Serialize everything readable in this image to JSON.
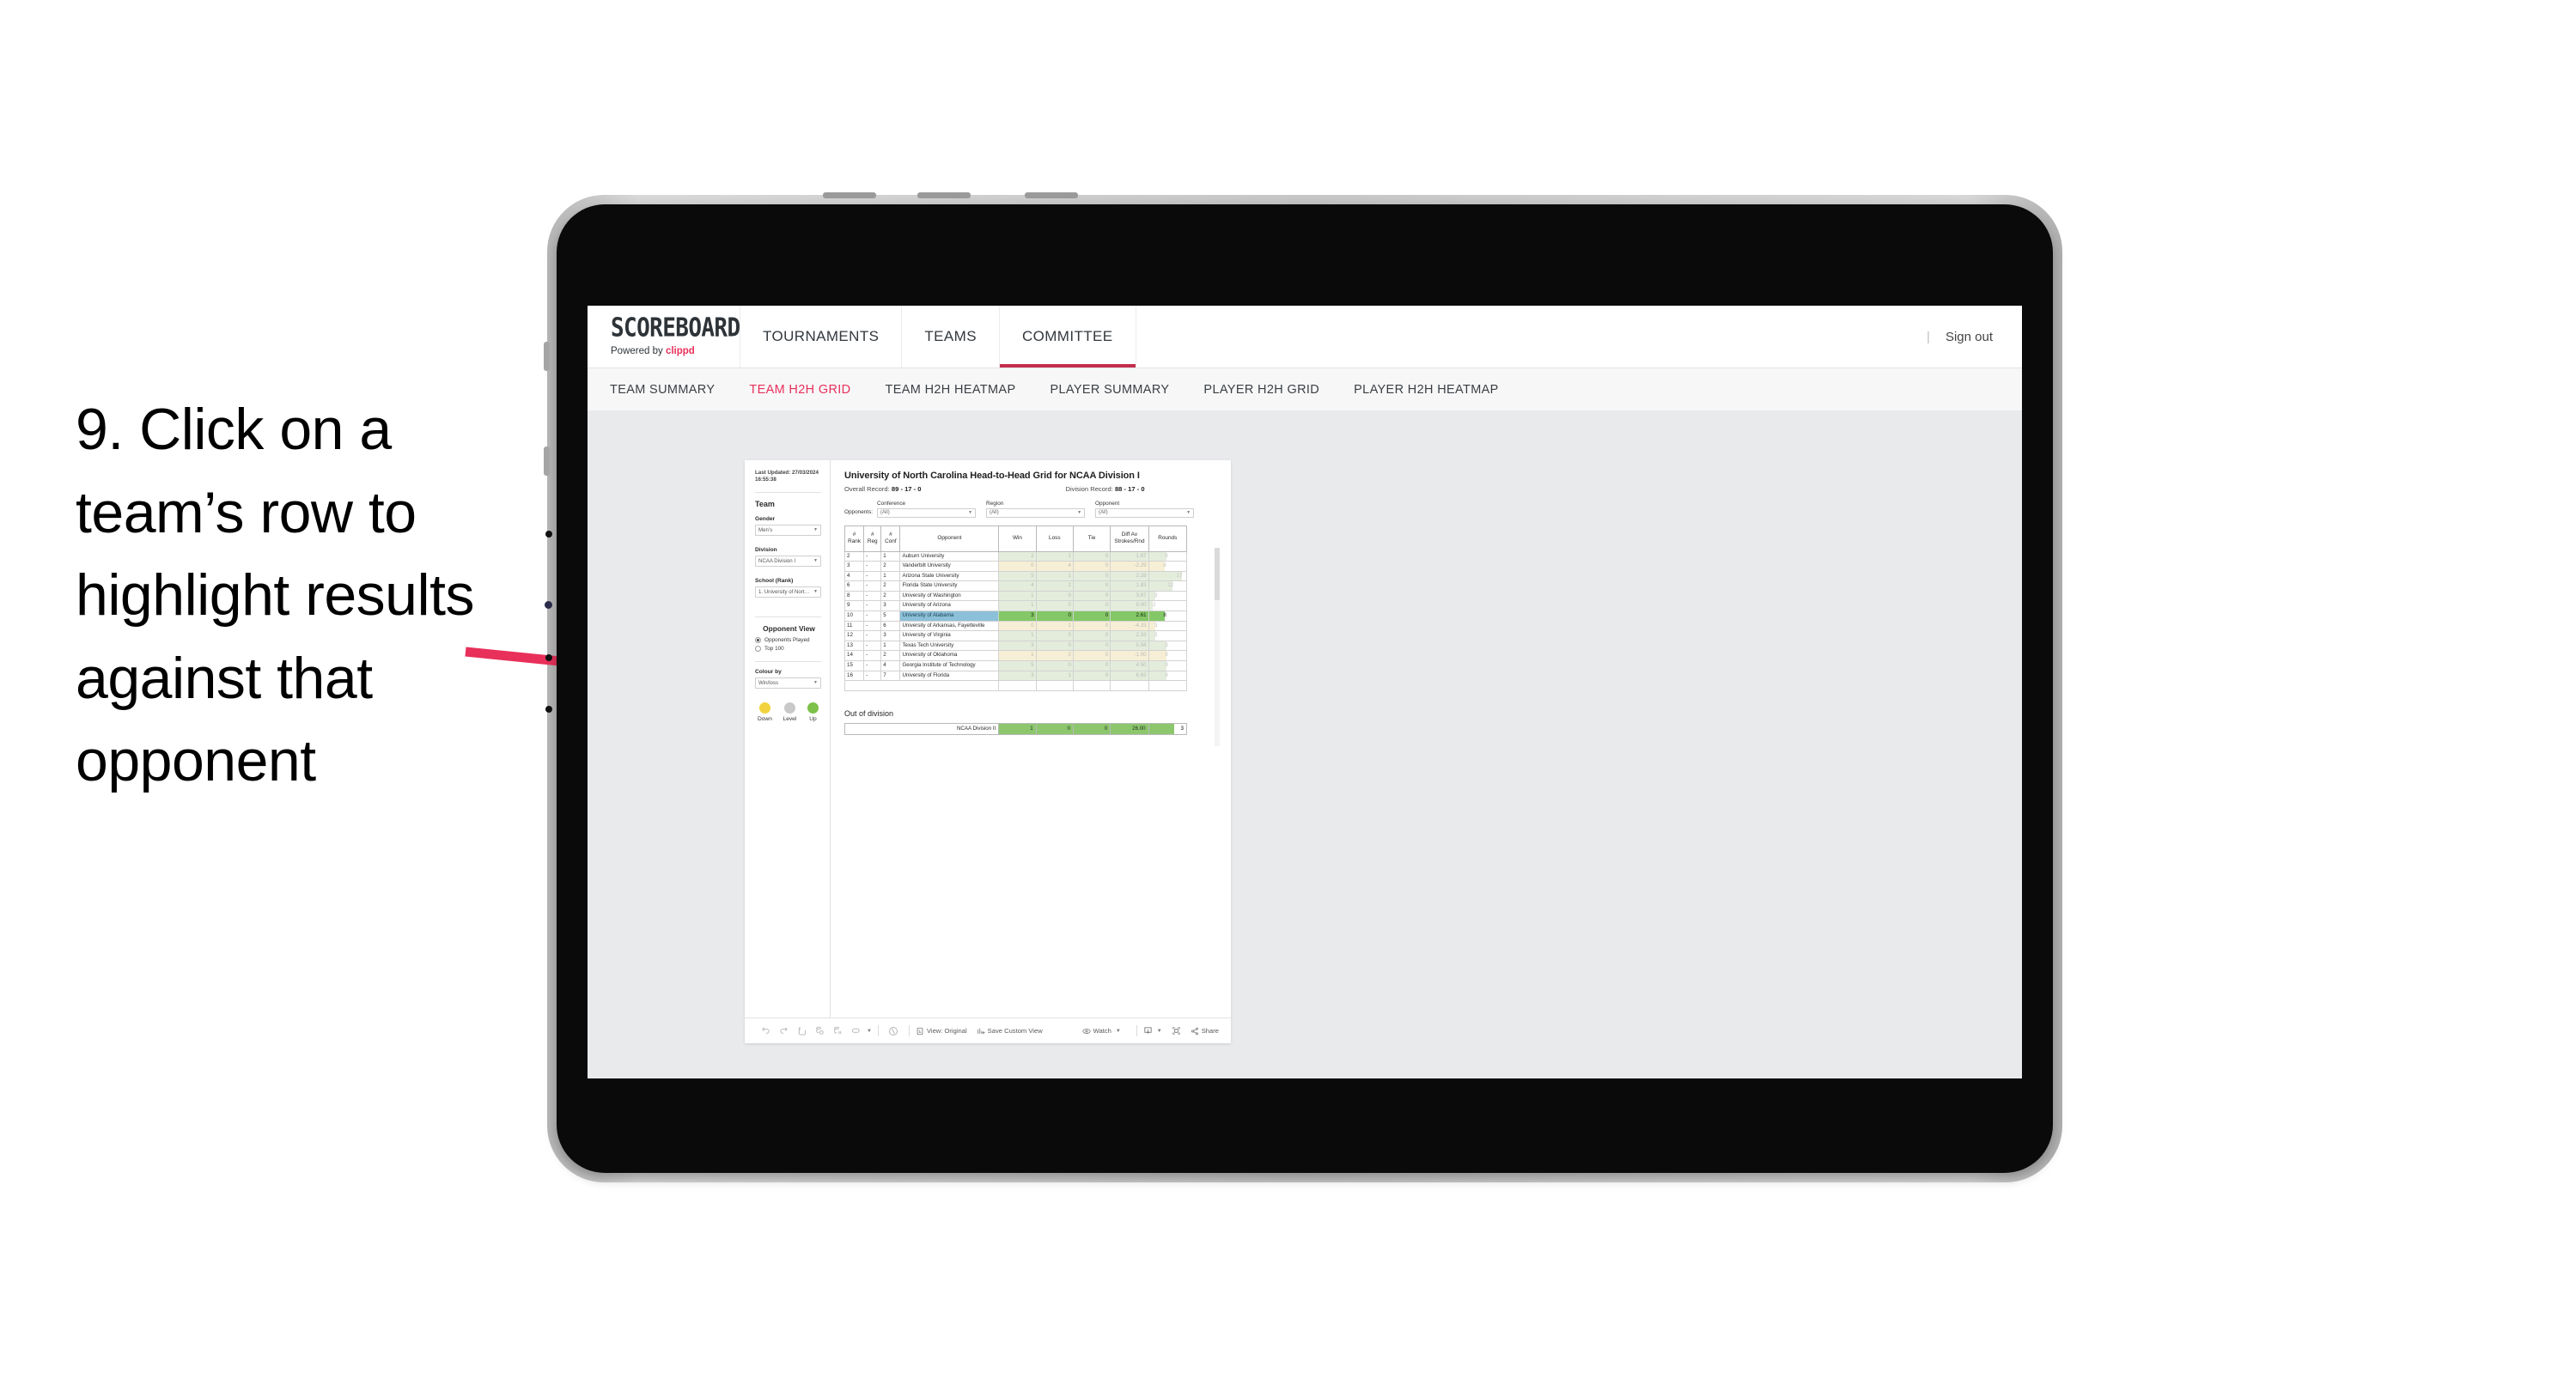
{
  "annotation": {
    "text": "9. Click on a team’s row to highlight results against that opponent",
    "arrow_color": "#E8305A"
  },
  "topnav": {
    "brand_name": "SCOREBOARD",
    "brand_sub_prefix": "Powered by ",
    "brand_sub_accent": "clippd",
    "items": [
      {
        "label": "TOURNAMENTS",
        "active": false
      },
      {
        "label": "TEAMS",
        "active": false
      },
      {
        "label": "COMMITTEE",
        "active": true
      }
    ],
    "divider": "|",
    "signout_label": "Sign out"
  },
  "subnav": {
    "items": [
      {
        "label": "TEAM SUMMARY",
        "active": false
      },
      {
        "label": "TEAM H2H GRID",
        "active": true
      },
      {
        "label": "TEAM H2H HEATMAP",
        "active": false
      },
      {
        "label": "PLAYER SUMMARY",
        "active": false
      },
      {
        "label": "PLAYER H2H GRID",
        "active": false
      },
      {
        "label": "PLAYER H2H HEATMAP",
        "active": false
      }
    ]
  },
  "sidebar": {
    "last_updated": "Last Updated: 27/03/2024 16:55:38",
    "team_heading": "Team",
    "gender_label": "Gender",
    "gender_value": "Men’s",
    "division_label": "Division",
    "division_value": "NCAA Division I",
    "school_label": "School (Rank)",
    "school_value": "1. University of Nort…",
    "opponent_view_heading": "Opponent View",
    "opponent_view_options": [
      {
        "label": "Opponents Played",
        "selected": true
      },
      {
        "label": "Top 100",
        "selected": false
      }
    ],
    "colour_by_label": "Colour by",
    "colour_by_value": "Win/loss",
    "legend": [
      {
        "label": "Down",
        "color": "#F2D33F"
      },
      {
        "label": "Level",
        "color": "#C9C9C9"
      },
      {
        "label": "Up",
        "color": "#7DC14A"
      }
    ]
  },
  "viz": {
    "title": "University of North Carolina Head-to-Head Grid for NCAA Division I",
    "overall_record_label": "Overall Record:",
    "overall_record_value": "89 - 17 - 0",
    "division_record_label": "Division Record:",
    "division_record_value": "88 - 17 - 0",
    "opponents_label": "Opponents:",
    "filters": [
      {
        "caption": "Conference",
        "value": "(All)"
      },
      {
        "caption": "Region",
        "value": "(All)"
      },
      {
        "caption": "Opponent",
        "value": "(All)"
      }
    ],
    "out_of_division_title": "Out of division"
  },
  "chart_data": {
    "type": "table",
    "title": "University of North Carolina Head-to-Head Grid for NCAA Division I",
    "columns": [
      "# Rank",
      "# Reg",
      "# Conf",
      "Opponent",
      "Win",
      "Loss",
      "Tie",
      "Diff Av Strokes/Rnd",
      "Rounds"
    ],
    "column_headers_multiline": [
      [
        "#",
        "Rank"
      ],
      [
        "#",
        "Reg"
      ],
      [
        "#",
        "Conf"
      ],
      [
        "",
        "Opponent"
      ],
      [
        "Win",
        ""
      ],
      [
        "Loss",
        ""
      ],
      [
        "Tie",
        ""
      ],
      [
        "Diff Av",
        "Strokes/Rnd"
      ],
      [
        "Rounds",
        ""
      ]
    ],
    "rows": [
      {
        "rank": "2",
        "reg": "-",
        "conf": "1",
        "opponent": "Auburn University",
        "win": "2",
        "loss": "1",
        "tie": "0",
        "diff": "1.67",
        "rounds": "9",
        "result": "up",
        "selected": false,
        "rounds_pct": 47
      },
      {
        "rank": "3",
        "reg": "-",
        "conf": "2",
        "opponent": "Vanderbilt University",
        "win": "0",
        "loss": "4",
        "tie": "0",
        "diff": "-2.29",
        "rounds": "8",
        "result": "down",
        "selected": false,
        "rounds_pct": 42
      },
      {
        "rank": "4",
        "reg": "-",
        "conf": "1",
        "opponent": "Arizona State University",
        "win": "5",
        "loss": "1",
        "tie": "0",
        "diff": "2.28",
        "rounds": "17",
        "result": "up",
        "selected": false,
        "rounds_pct": 89
      },
      {
        "rank": "6",
        "reg": "-",
        "conf": "2",
        "opponent": "Florida State University",
        "win": "4",
        "loss": "2",
        "tie": "0",
        "diff": "1.83",
        "rounds": "12",
        "result": "up",
        "selected": false,
        "rounds_pct": 63
      },
      {
        "rank": "8",
        "reg": "-",
        "conf": "2",
        "opponent": "University of Washington",
        "win": "1",
        "loss": "0",
        "tie": "0",
        "diff": "3.67",
        "rounds": "3",
        "result": "up",
        "selected": false,
        "rounds_pct": 16
      },
      {
        "rank": "9",
        "reg": "-",
        "conf": "3",
        "opponent": "University of Arizona",
        "win": "1",
        "loss": "0",
        "tie": "0",
        "diff": "9.00",
        "rounds": "2",
        "result": "up",
        "selected": false,
        "rounds_pct": 11
      },
      {
        "rank": "10",
        "reg": "-",
        "conf": "5",
        "opponent": "University of Alabama",
        "win": "3",
        "loss": "0",
        "tie": "0",
        "diff": "2.61",
        "rounds": "8",
        "result": "up",
        "selected": true,
        "rounds_pct": 42
      },
      {
        "rank": "11",
        "reg": "-",
        "conf": "6",
        "opponent": "University of Arkansas, Fayetteville",
        "win": "0",
        "loss": "1",
        "tie": "0",
        "diff": "-4.33",
        "rounds": "3",
        "result": "down",
        "selected": false,
        "rounds_pct": 16
      },
      {
        "rank": "12",
        "reg": "-",
        "conf": "3",
        "opponent": "University of Virginia",
        "win": "1",
        "loss": "0",
        "tie": "0",
        "diff": "2.33",
        "rounds": "3",
        "result": "up",
        "selected": false,
        "rounds_pct": 16
      },
      {
        "rank": "13",
        "reg": "-",
        "conf": "1",
        "opponent": "Texas Tech University",
        "win": "3",
        "loss": "0",
        "tie": "0",
        "diff": "5.56",
        "rounds": "9",
        "result": "up",
        "selected": false,
        "rounds_pct": 47
      },
      {
        "rank": "14",
        "reg": "-",
        "conf": "2",
        "opponent": "University of Oklahoma",
        "win": "1",
        "loss": "2",
        "tie": "0",
        "diff": "-1.00",
        "rounds": "9",
        "result": "down",
        "selected": false,
        "rounds_pct": 47
      },
      {
        "rank": "15",
        "reg": "-",
        "conf": "4",
        "opponent": "Georgia Institute of Technology",
        "win": "5",
        "loss": "0",
        "tie": "0",
        "diff": "4.50",
        "rounds": "9",
        "result": "up",
        "selected": false,
        "rounds_pct": 47
      },
      {
        "rank": "16",
        "reg": "-",
        "conf": "7",
        "opponent": "University of Florida",
        "win": "3",
        "loss": "1",
        "tie": "0",
        "diff": "6.62",
        "rounds": "9",
        "result": "up",
        "selected": false,
        "rounds_pct": 47
      }
    ],
    "out_of_division_row": {
      "label": "NCAA Division II",
      "win": "1",
      "loss": "0",
      "tie": "0",
      "diff": "26.00",
      "rounds": "3"
    },
    "colors": {
      "up": "#E4EDDC",
      "down": "#F7EFD5",
      "selected_green": "#83C766",
      "selected_name": "#8CC0D9",
      "ood_green": "#8CC76E"
    }
  },
  "toolbar": {
    "view_label": "View: Original",
    "save_label": "Save Custom View",
    "watch_label": "Watch",
    "share_label": "Share"
  }
}
